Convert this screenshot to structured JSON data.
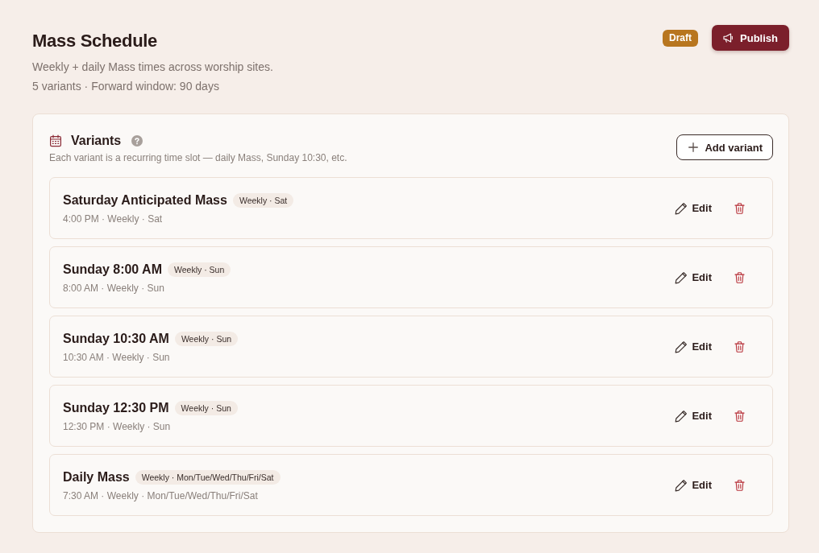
{
  "header": {
    "title": "Mass Schedule",
    "description": "Weekly + daily Mass times across worship sites.",
    "summary": "5 variants · Forward window: 90 days",
    "status_badge": "Draft",
    "publish_button": "Publish"
  },
  "variants_panel": {
    "title": "Variants",
    "description": "Each variant is a recurring time slot — daily Mass, Sunday 10:30, etc.",
    "add_button": "Add variant",
    "variants": [
      {
        "name": "Saturday Anticipated Mass",
        "tag": "Weekly · Sat",
        "details": "4:00 PM · Weekly · Sat",
        "edit_label": "Edit"
      },
      {
        "name": "Sunday 8:00 AM",
        "tag": "Weekly · Sun",
        "details": "8:00 AM · Weekly · Sun",
        "edit_label": "Edit"
      },
      {
        "name": "Sunday 10:30 AM",
        "tag": "Weekly · Sun",
        "details": "10:30 AM · Weekly · Sun",
        "edit_label": "Edit"
      },
      {
        "name": "Sunday 12:30 PM",
        "tag": "Weekly · Sun",
        "details": "12:30 PM · Weekly · Sun",
        "edit_label": "Edit"
      },
      {
        "name": "Daily Mass",
        "tag": "Weekly · Mon/Tue/Wed/Thu/Fri/Sat",
        "details": "7:30 AM · Weekly · Mon/Tue/Wed/Thu/Fri/Sat",
        "edit_label": "Edit"
      }
    ]
  }
}
